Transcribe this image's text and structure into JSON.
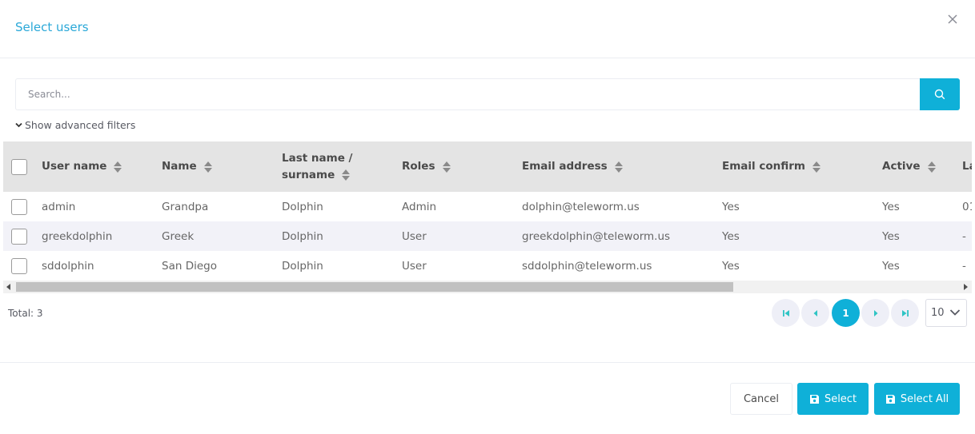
{
  "modal": {
    "title": "Select users"
  },
  "search": {
    "placeholder": "Search..."
  },
  "filters": {
    "toggle_label": "Show advanced filters"
  },
  "table": {
    "columns": [
      "User name",
      "Name",
      "Last name /",
      "surname",
      "Roles",
      "Email address",
      "Email confirm",
      "Active",
      "La"
    ],
    "rows": [
      {
        "username": "admin",
        "name": "Grandpa",
        "surname": "Dolphin",
        "roles": "Admin",
        "email": "dolphin@teleworm.us",
        "email_confirm": "Yes",
        "active": "Yes",
        "last": "01"
      },
      {
        "username": "greekdolphin",
        "name": "Greek",
        "surname": "Dolphin",
        "roles": "User",
        "email": "greekdolphin@teleworm.us",
        "email_confirm": "Yes",
        "active": "Yes",
        "last": "-"
      },
      {
        "username": "sddolphin",
        "name": "San Diego",
        "surname": "Dolphin",
        "roles": "User",
        "email": "sddolphin@teleworm.us",
        "email_confirm": "Yes",
        "active": "Yes",
        "last": "-"
      }
    ]
  },
  "footer": {
    "total": "Total: 3"
  },
  "pagination": {
    "current_page": "1",
    "page_size": "10"
  },
  "actions": {
    "cancel": "Cancel",
    "select": "Select",
    "select_all": "Select All"
  },
  "colors": {
    "accent": "#0fb0d8",
    "title": "#2aa8d8",
    "header_bg": "#e4e4e4",
    "row_alt": "#f2f2f8"
  },
  "icons": [
    "close-icon",
    "search-icon",
    "chevron-down-icon",
    "sort-icon",
    "first-page-icon",
    "prev-page-icon",
    "next-page-icon",
    "last-page-icon",
    "save-icon"
  ]
}
